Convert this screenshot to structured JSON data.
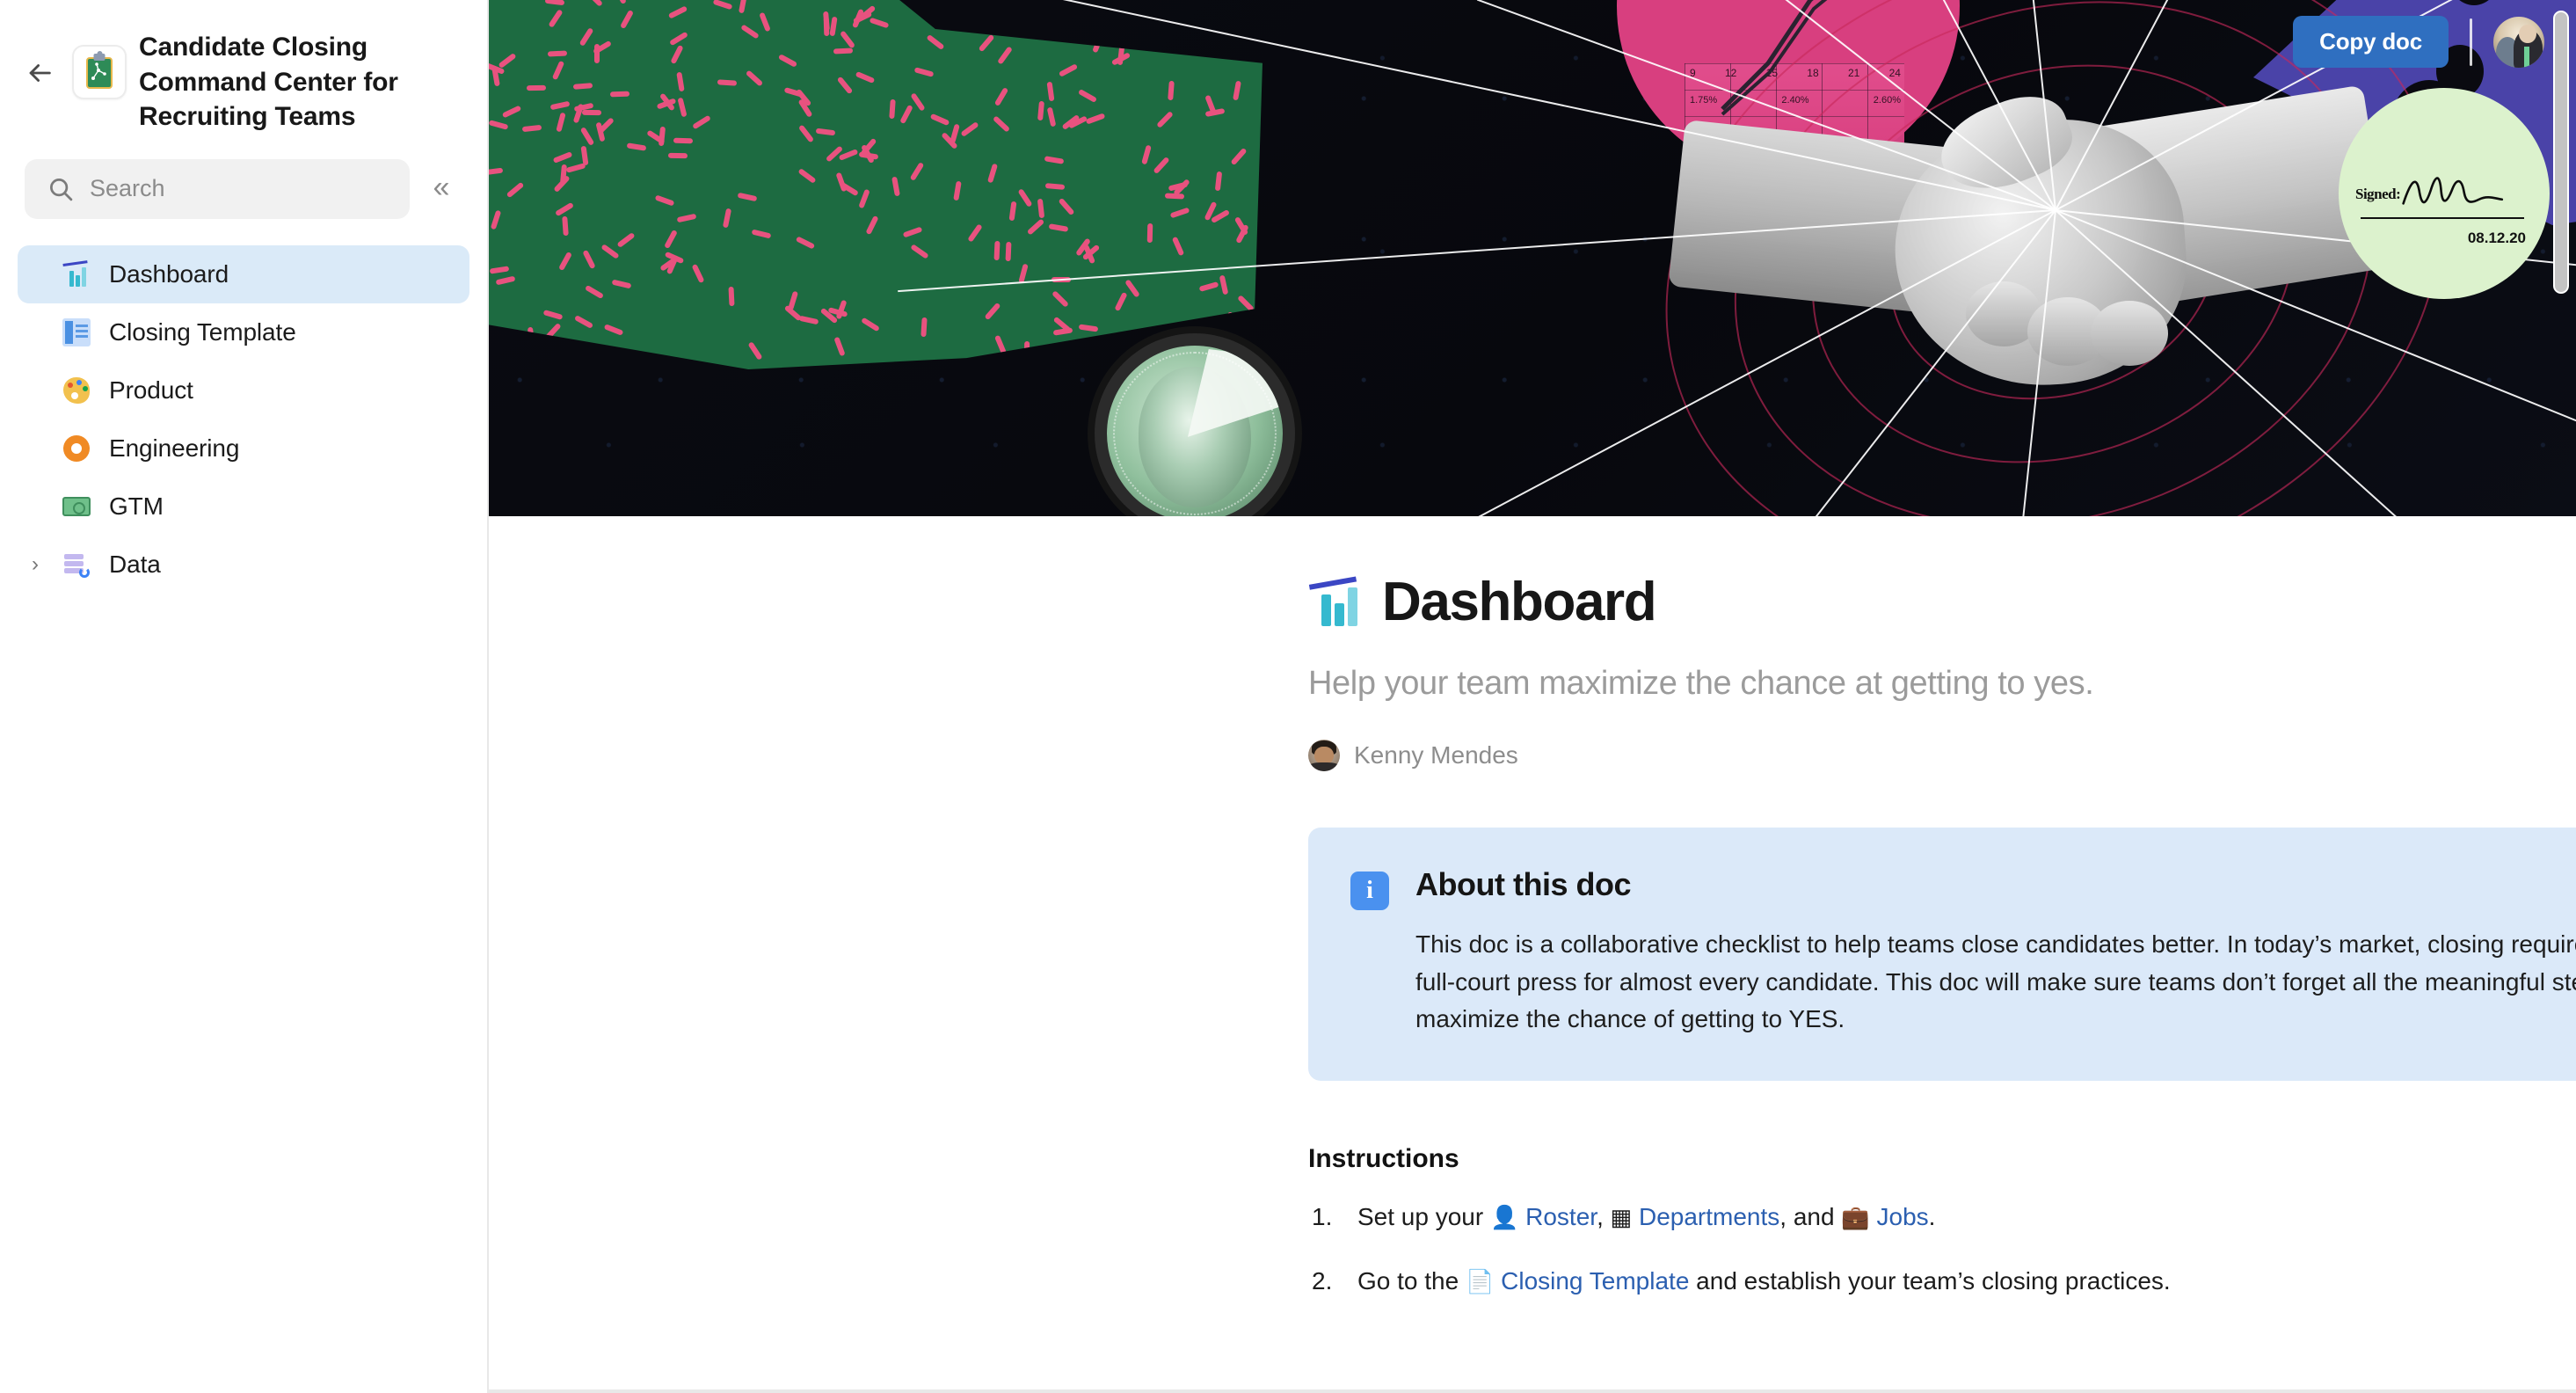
{
  "sidebar": {
    "back_icon": "back-arrow-icon",
    "doc_icon": "clipboard-strategy-icon",
    "doc_title": "Candidate Closing Command Center for Recruiting Teams",
    "search": {
      "placeholder": "Search",
      "icon": "search-icon"
    },
    "collapse_icon": "«",
    "items": [
      {
        "label": "Dashboard",
        "icon": "bar-chart-icon",
        "active": true,
        "expandable": false
      },
      {
        "label": "Closing Template",
        "icon": "document-icon",
        "active": false,
        "expandable": false
      },
      {
        "label": "Product",
        "icon": "palette-icon",
        "active": false,
        "expandable": false
      },
      {
        "label": "Engineering",
        "icon": "gear-icon",
        "active": false,
        "expandable": false
      },
      {
        "label": "GTM",
        "icon": "money-icon",
        "active": false,
        "expandable": false
      },
      {
        "label": "Data",
        "icon": "database-icon",
        "active": false,
        "expandable": true,
        "chevron": "›"
      }
    ]
  },
  "header": {
    "copy_doc_label": "Copy doc",
    "avatar": "user-avatar"
  },
  "hero": {
    "signature_label": "Signed:",
    "signature_date": "08.12.20",
    "sheet_numbers": [
      "9",
      "12",
      "15",
      "18",
      "21",
      "24"
    ],
    "sheet_percents": [
      "1.75%",
      "2.40%",
      "2.60%"
    ]
  },
  "page": {
    "icon": "bar-chart-icon",
    "title": "Dashboard",
    "subtitle": "Help your team maximize the chance at getting to yes.",
    "author": "Kenny Mendes"
  },
  "callout": {
    "icon": "info-icon",
    "heading": "About this doc",
    "body": "This doc is a collaborative checklist to help teams close candidates better. In today’s market, closing requires a full-court press for almost every candidate. This doc will make sure teams don’t forget all the meaningful steps to maximize the chance of getting to YES."
  },
  "instructions": {
    "heading": "Instructions",
    "steps": [
      {
        "parts": [
          {
            "t": "text",
            "v": "Set up your "
          },
          {
            "t": "emoji",
            "v": "👤"
          },
          {
            "t": "link",
            "v": " Roster"
          },
          {
            "t": "text",
            "v": ", "
          },
          {
            "t": "emoji",
            "v": "▦"
          },
          {
            "t": "link",
            "v": " Departments"
          },
          {
            "t": "text",
            "v": ", and "
          },
          {
            "t": "emoji",
            "v": "💼"
          },
          {
            "t": "link",
            "v": " Jobs"
          },
          {
            "t": "text",
            "v": "."
          }
        ]
      },
      {
        "parts": [
          {
            "t": "text",
            "v": "Go to the "
          },
          {
            "t": "emoji",
            "v": "📄"
          },
          {
            "t": "link",
            "v": " Closing Template"
          },
          {
            "t": "text",
            "v": " and establish your team’s closing practices."
          }
        ]
      }
    ]
  },
  "colors": {
    "accent_blue": "#2f6fc0",
    "active_nav": "#daeaf8",
    "callout_bg": "#dbe9f9",
    "link": "#2b5fb0",
    "hero_green": "#1d6b41",
    "hero_pink": "#d83f7f",
    "hero_purple": "#4a43a8",
    "hero_mint": "#dcf2cd"
  }
}
